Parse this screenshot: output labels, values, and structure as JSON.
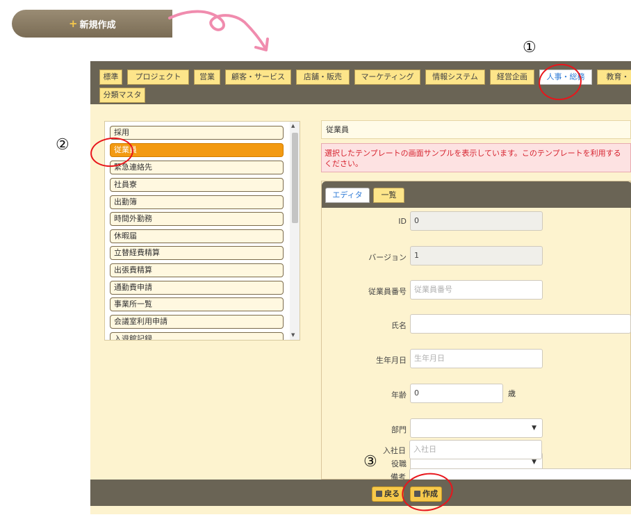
{
  "new_button": {
    "label": "新規作成"
  },
  "annotations": {
    "one": "①",
    "two": "②",
    "three": "③"
  },
  "category_tabs": [
    {
      "label": "標準"
    },
    {
      "label": "プロジェクト"
    },
    {
      "label": "営業"
    },
    {
      "label": "顧客・サービス"
    },
    {
      "label": "店舗・販売"
    },
    {
      "label": "マーケティング"
    },
    {
      "label": "情報システム"
    },
    {
      "label": "経営企画"
    },
    {
      "label": "人事・総務"
    },
    {
      "label": "教育・"
    },
    {
      "label": "分類マスタ"
    }
  ],
  "template_list": [
    {
      "label": "採用"
    },
    {
      "label": "従業員"
    },
    {
      "label": "緊急連絡先"
    },
    {
      "label": "社員寮"
    },
    {
      "label": "出勤簿"
    },
    {
      "label": "時間外勤務"
    },
    {
      "label": "休暇届"
    },
    {
      "label": "立替経費精算"
    },
    {
      "label": "出張費精算"
    },
    {
      "label": "通勤費申請"
    },
    {
      "label": "事業所一覧"
    },
    {
      "label": "会議室利用申請"
    },
    {
      "label": "入退館記録"
    }
  ],
  "selected_template": "従業員",
  "notice": {
    "line1": "選択したテンプレートの画面サンプルを表示しています。このテンプレートを利用する",
    "line2": "ください。"
  },
  "form_tabs": {
    "editor": "エディタ",
    "list": "一覧"
  },
  "form": {
    "id_label": "ID",
    "id_value": "0",
    "version_label": "バージョン",
    "version_value": "1",
    "empno_label": "従業員番号",
    "empno_placeholder": "従業員番号",
    "name_label": "氏名",
    "name_value": "",
    "birth_label": "生年月日",
    "birth_placeholder": "生年月日",
    "age_label": "年齢",
    "age_value": "0",
    "age_unit": "歳",
    "dept_label": "部門",
    "dept_value": "",
    "position_label": "役職",
    "position_value": "",
    "hire_label": "入社日",
    "hire_placeholder": "入社日",
    "remarks_label": "備考"
  },
  "footer": {
    "back": "戻る",
    "create": "作成"
  },
  "colors": {
    "accent": "#f39a12",
    "annotation": "#e8151b",
    "tabbar": "#6a6455",
    "panel_bg": "#fdf3cf"
  }
}
